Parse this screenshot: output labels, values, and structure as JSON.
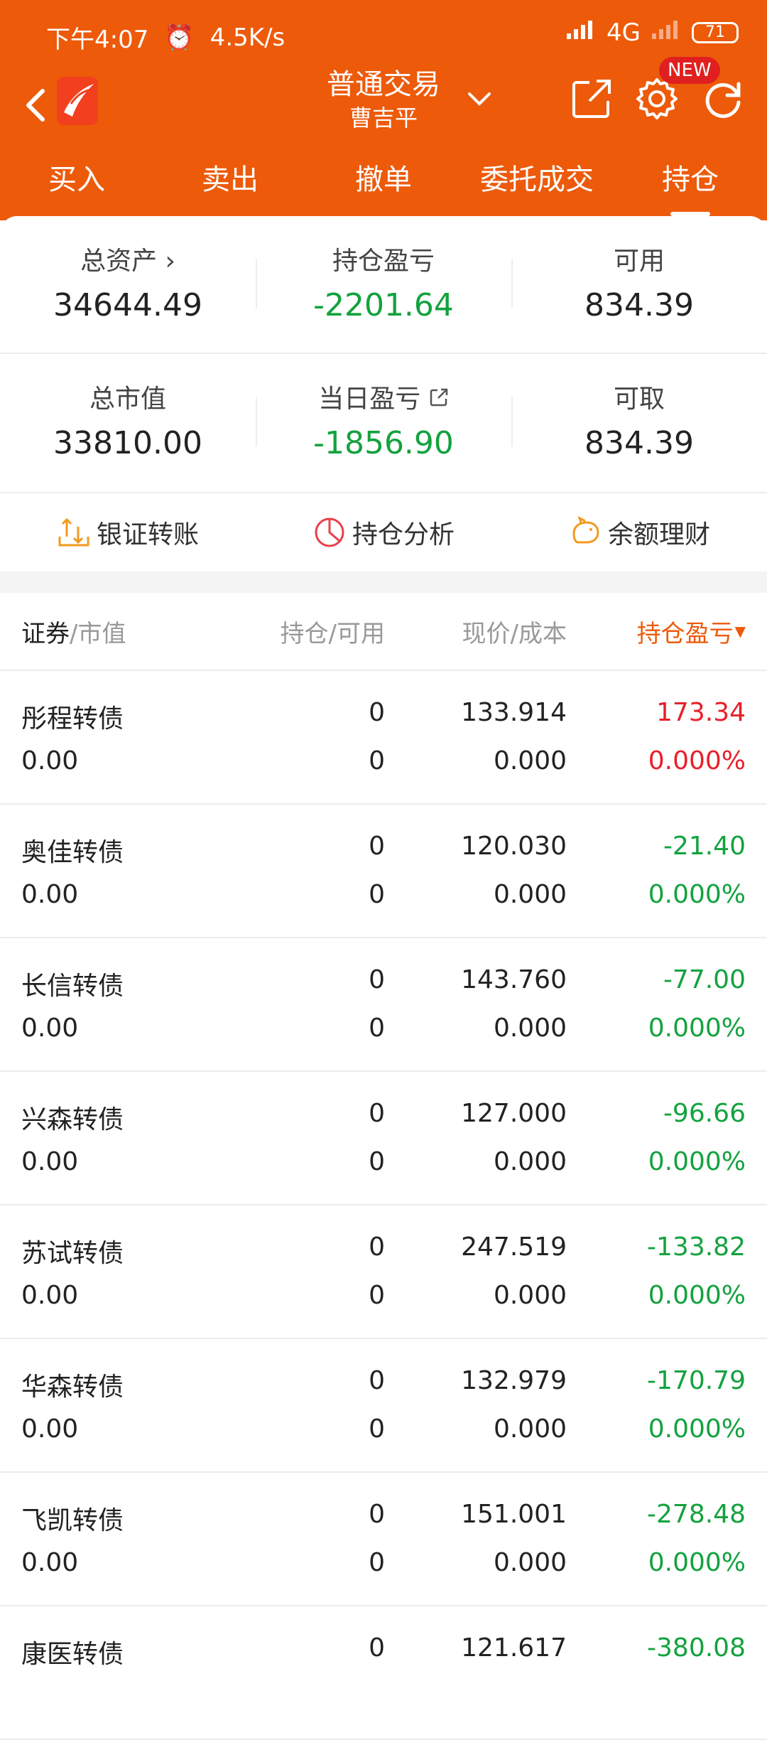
{
  "status_bar": {
    "time": "下午4:07",
    "net_speed": "4.5K/s",
    "network": "4G",
    "battery": "71"
  },
  "header": {
    "title": "普通交易",
    "subtitle": "曹吉平",
    "new_badge": "NEW"
  },
  "tabs": [
    "买入",
    "卖出",
    "撤单",
    "委托成交",
    "持仓"
  ],
  "summary": {
    "row1": [
      {
        "label": "总资产 ›",
        "value": "34644.49"
      },
      {
        "label": "持仓盈亏",
        "value": "-2201.64"
      },
      {
        "label": "可用",
        "value": "834.39"
      }
    ],
    "row2": [
      {
        "label": "总市值",
        "value": "33810.00"
      },
      {
        "label": "当日盈亏",
        "value": "-1856.90"
      },
      {
        "label": "可取",
        "value": "834.39"
      }
    ]
  },
  "actions": [
    {
      "label": "银证转账",
      "icon": "transfer-icon"
    },
    {
      "label": "持仓分析",
      "icon": "pie-chart-icon"
    },
    {
      "label": "余额理财",
      "icon": "piggy-bank-icon"
    }
  ],
  "table": {
    "header": {
      "c1_main": "证券",
      "c1_sub": "/市值",
      "c2": "持仓/可用",
      "c3": "现价/成本",
      "c4": "持仓盈亏"
    },
    "rows": [
      {
        "name": "彤程转债",
        "mv": "0.00",
        "hold": "0",
        "avail": "0",
        "price": "133.914",
        "cost": "0.000",
        "pnl": "173.34",
        "pct": "0.000%"
      },
      {
        "name": "奥佳转债",
        "mv": "0.00",
        "hold": "0",
        "avail": "0",
        "price": "120.030",
        "cost": "0.000",
        "pnl": "-21.40",
        "pct": "0.000%"
      },
      {
        "name": "长信转债",
        "mv": "0.00",
        "hold": "0",
        "avail": "0",
        "price": "143.760",
        "cost": "0.000",
        "pnl": "-77.00",
        "pct": "0.000%"
      },
      {
        "name": "兴森转债",
        "mv": "0.00",
        "hold": "0",
        "avail": "0",
        "price": "127.000",
        "cost": "0.000",
        "pnl": "-96.66",
        "pct": "0.000%"
      },
      {
        "name": "苏试转债",
        "mv": "0.00",
        "hold": "0",
        "avail": "0",
        "price": "247.519",
        "cost": "0.000",
        "pnl": "-133.82",
        "pct": "0.000%"
      },
      {
        "name": "华森转债",
        "mv": "0.00",
        "hold": "0",
        "avail": "0",
        "price": "132.979",
        "cost": "0.000",
        "pnl": "-170.79",
        "pct": "0.000%"
      },
      {
        "name": "飞凯转债",
        "mv": "0.00",
        "hold": "0",
        "avail": "0",
        "price": "151.001",
        "cost": "0.000",
        "pnl": "-278.48",
        "pct": "0.000%"
      },
      {
        "name": "康医转债",
        "mv": "",
        "hold": "0",
        "avail": "",
        "price": "121.617",
        "cost": "",
        "pnl": "-380.08",
        "pct": ""
      }
    ]
  },
  "colors": {
    "brand": "#ED5A0A",
    "loss": "#13A23E",
    "gain": "#E8202A"
  }
}
